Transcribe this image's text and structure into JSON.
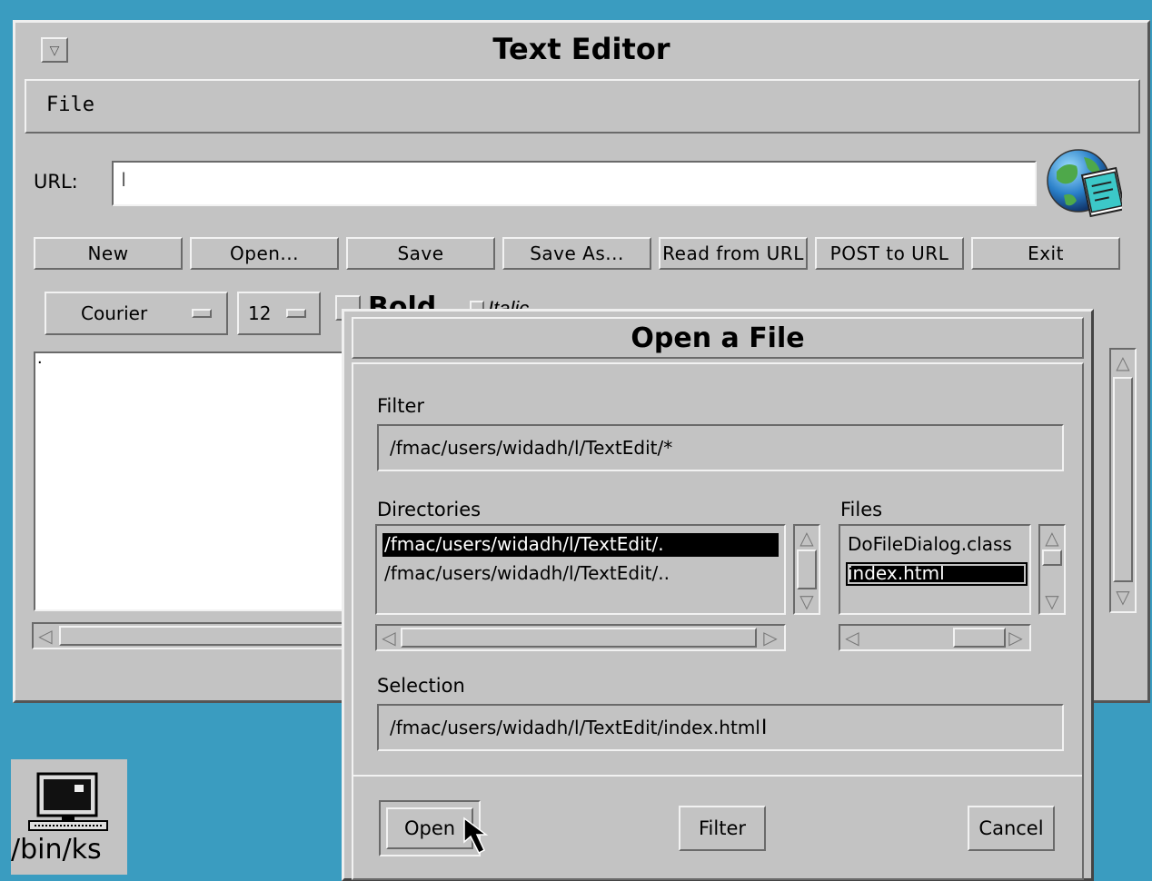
{
  "window": {
    "title": "Text Editor",
    "menu_button": "▽"
  },
  "menubar": {
    "file": "File"
  },
  "url": {
    "label": "URL:",
    "value": "",
    "cursor": "I"
  },
  "toolbar": {
    "new": "New",
    "open": "Open...",
    "save": "Save",
    "save_as": "Save As...",
    "read_url": "Read from URL",
    "post_url": "POST to URL",
    "exit": "Exit"
  },
  "format": {
    "font": "Courier",
    "size": "12",
    "bold": "Bold",
    "italic": "Italic"
  },
  "editor": {
    "content": "."
  },
  "arrows": {
    "up": "△",
    "down": "▽",
    "left": "◁",
    "right": "▷"
  },
  "desktop": {
    "icon_label": "/bin/ks"
  },
  "dialog": {
    "title": "Open a File",
    "filter_label": "Filter",
    "filter_value": "/fmac/users/widadh/l/TextEdit/*",
    "directories_label": "Directories",
    "directories": [
      "/fmac/users/widadh/l/TextEdit/.",
      "/fmac/users/widadh/l/TextEdit/.."
    ],
    "files_label": "Files",
    "files": [
      "DoFileDialog.class",
      "index.html"
    ],
    "selection_label": "Selection",
    "selection_value": "/fmac/users/widadh/l/TextEdit/index.html",
    "open_button": "Open",
    "filter_button": "Filter",
    "cancel_button": "Cancel"
  }
}
